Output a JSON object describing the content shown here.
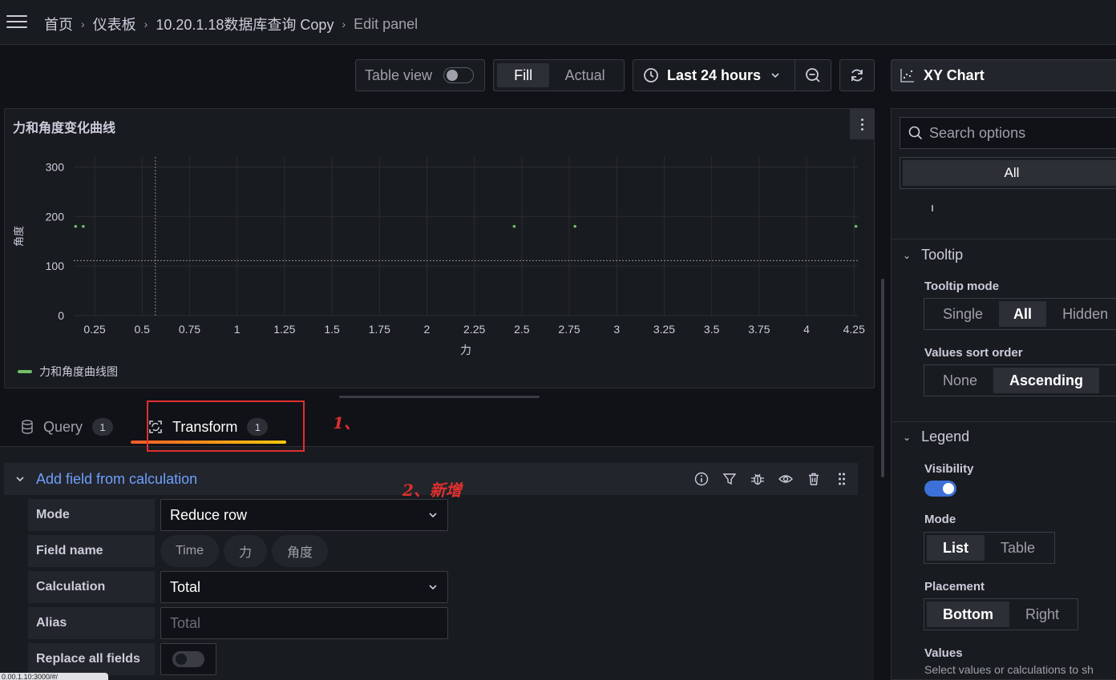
{
  "breadcrumb": [
    "首页",
    "仪表板",
    "10.20.1.18数据库查询 Copy",
    "Edit panel"
  ],
  "toolbar": {
    "table_view": "Table view",
    "fill": "Fill",
    "actual": "Actual",
    "time_range": "Last 24 hours",
    "viz": "XY Chart"
  },
  "panel": {
    "title": "力和角度变化曲线",
    "legend": "力和角度曲线图"
  },
  "chart_data": {
    "type": "scatter",
    "xlabel": "力",
    "ylabel": "角度",
    "xlim": [
      0.14,
      4.27
    ],
    "ylim": [
      0,
      320
    ],
    "x_ticks": [
      "0.25",
      "0.5",
      "0.75",
      "1",
      "1.25",
      "1.5",
      "1.75",
      "2",
      "2.25",
      "2.5",
      "2.75",
      "3",
      "3.25",
      "3.5",
      "3.75",
      "4",
      "4.25"
    ],
    "y_ticks": [
      "0",
      "100",
      "200",
      "300"
    ],
    "series": [
      {
        "name": "力和角度曲线图",
        "color": "#73bf69",
        "points": [
          [
            0.15,
            180
          ],
          [
            0.19,
            180
          ],
          [
            2.46,
            180
          ],
          [
            2.78,
            180
          ],
          [
            4.26,
            180
          ]
        ]
      }
    ]
  },
  "tabs": {
    "query": "Query",
    "query_count": "1",
    "transform": "Transform",
    "transform_count": "1"
  },
  "annotations": {
    "one": "1、",
    "two": "2、新增"
  },
  "transform": {
    "title": "Add field from calculation",
    "mode_label": "Mode",
    "mode_value": "Reduce row",
    "field_name_label": "Field name",
    "fields": [
      "Time",
      "力",
      "角度"
    ],
    "calculation_label": "Calculation",
    "calculation_value": "Total",
    "alias_label": "Alias",
    "alias_placeholder": "Total",
    "replace_label": "Replace all fields"
  },
  "status_url": "0.00.1.10:3000/#/",
  "options": {
    "search_placeholder": "Search options",
    "all": "All",
    "tooltip": {
      "title": "Tooltip",
      "mode_label": "Tooltip mode",
      "modes": [
        "Single",
        "All",
        "Hidden"
      ],
      "sort_label": "Values sort order",
      "sorts": [
        "None",
        "Ascending"
      ]
    },
    "legend": {
      "title": "Legend",
      "visibility_label": "Visibility",
      "mode_label": "Mode",
      "modes": [
        "List",
        "Table"
      ],
      "placement_label": "Placement",
      "placements": [
        "Bottom",
        "Right"
      ],
      "values_label": "Values",
      "values_desc": "Select values or calculations to sh"
    }
  }
}
